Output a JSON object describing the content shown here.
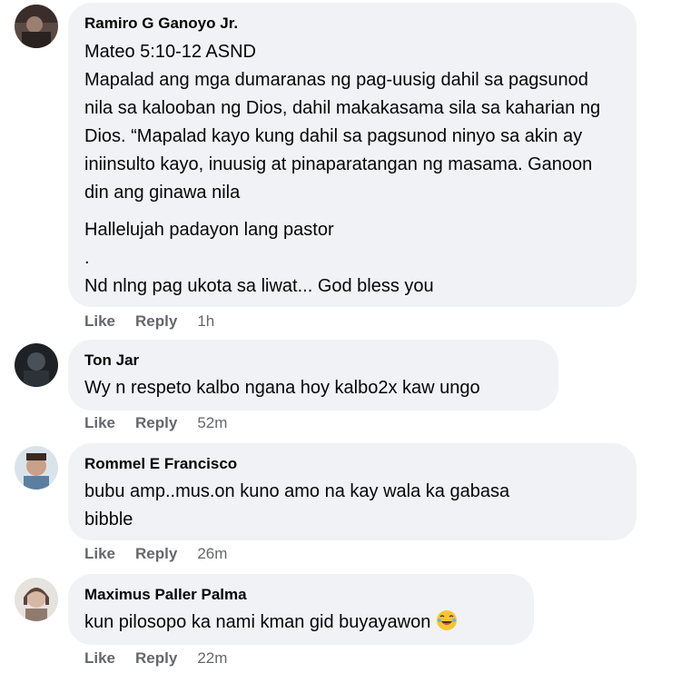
{
  "comments": [
    {
      "author": "Ramiro G Ganoyo Jr.",
      "paragraphs": [
        "Mateo 5:10-12 ASND\nMapalad ang mga dumaranas ng pag-uusig dahil sa pagsunod nila sa kalooban ng Dios, dahil makakasama sila sa kaharian ng Dios. “Mapalad kayo kung dahil sa pagsunod ninyo sa akin ay iniinsulto kayo, inuusig at pinaparatangan ng masama. Ganoon din ang ginawa nila",
        "Hallelujah padayon lang pastor\n.\nNd nlng pag ukota sa liwat... God bless you"
      ],
      "like": "Like",
      "reply": "Reply",
      "time": "1h"
    },
    {
      "author": "Ton Jar",
      "paragraphs": [
        "Wy n respeto kalbo ngana hoy kalbo2x kaw ungo"
      ],
      "like": "Like",
      "reply": "Reply",
      "time": "52m"
    },
    {
      "author": "Rommel E Francisco",
      "paragraphs": [
        "bubu amp..mus.on kuno amo na kay wala ka gabasa\nbibble"
      ],
      "like": "Like",
      "reply": "Reply",
      "time": "26m"
    },
    {
      "author": "Maximus Paller Palma",
      "paragraphs": [
        "kun pilosopo ka nami kman gid buyayawon"
      ],
      "emoji": "laughing-crying-emoji",
      "like": "Like",
      "reply": "Reply",
      "time": "22m"
    }
  ],
  "colors": {
    "bubble": "#f0f2f5",
    "text": "#050505",
    "meta": "#65676b"
  }
}
